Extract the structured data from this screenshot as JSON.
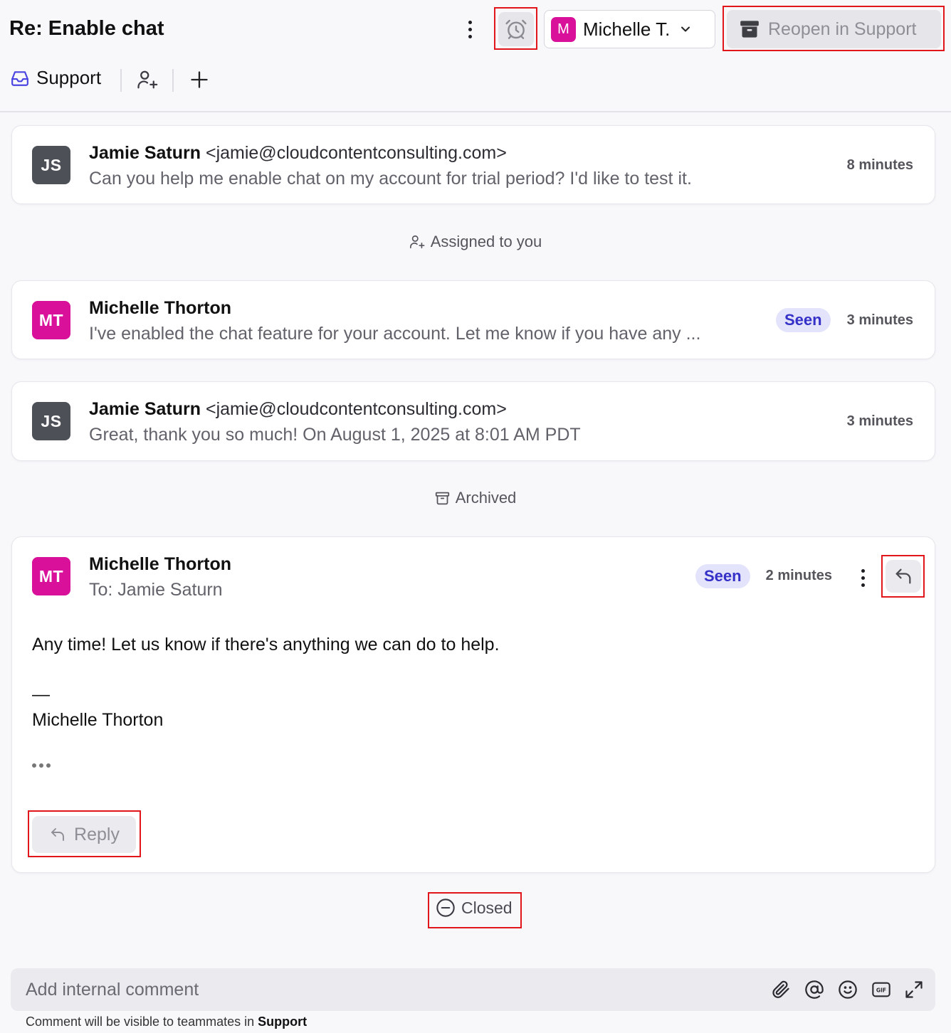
{
  "header": {
    "title": "Re: Enable chat",
    "assignee": {
      "initial": "M",
      "name": "Michelle T."
    },
    "reopen_label": "Reopen in Support",
    "inbox": "Support"
  },
  "messages": [
    {
      "initials": "JS",
      "sender": "Jamie Saturn",
      "email": "<jamie@cloudcontentconsulting.com>",
      "snippet": "Can you help me enable chat on my account for trial period? I'd like to test it.",
      "time": "8 minutes"
    },
    {
      "initials": "MT",
      "sender": "Michelle Thorton",
      "snippet": "I've enabled the chat feature for your account. Let me know if you have any ...",
      "seen": "Seen",
      "time": "3 minutes"
    },
    {
      "initials": "JS",
      "sender": "Jamie Saturn",
      "email": "<jamie@cloudcontentconsulting.com>",
      "snippet": "Great, thank you so much! On August 1, 2025 at 8:01 AM PDT",
      "time": "3 minutes"
    }
  ],
  "events": {
    "assigned": "Assigned to you",
    "archived": "Archived",
    "closed": "Closed"
  },
  "expanded": {
    "initials": "MT",
    "sender": "Michelle Thorton",
    "to": "To: Jamie Saturn",
    "seen": "Seen",
    "time": "2 minutes",
    "body": "Any time! Let us know if there's anything we can do to help.",
    "sig_dash": "—",
    "signature": "Michelle Thorton",
    "reply_label": "Reply"
  },
  "comment": {
    "placeholder": "Add internal comment",
    "footer_prefix": "Comment will be visible to teammates in",
    "footer_inbox": "Support"
  },
  "icons": [
    "kebab-icon",
    "alarm-clock-icon",
    "chevron-down-icon",
    "archive-icon",
    "inbox-icon",
    "add-person-icon",
    "plus-icon",
    "reply-icon",
    "minus-circle-icon",
    "paperclip-icon",
    "at-icon",
    "emoji-icon",
    "gif-icon",
    "expand-icon"
  ],
  "colors": {
    "accent": "#3430c8",
    "avatar_mt": "#d9119a",
    "avatar_js": "#4e5058",
    "highlight": "#e0161b"
  }
}
